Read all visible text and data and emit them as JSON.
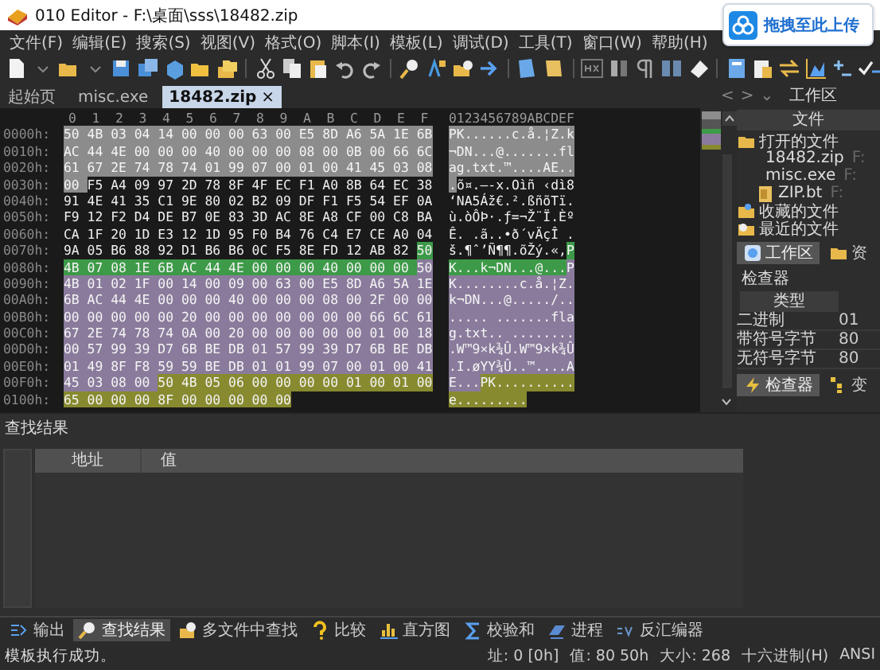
{
  "window": {
    "title": "010 Editor - F:\\桌面\\sss\\18482.zip"
  },
  "upload_widget": {
    "label": "拖拽至此上传"
  },
  "menu": [
    "文件(F)",
    "编辑(E)",
    "搜索(S)",
    "视图(V)",
    "格式(O)",
    "脚本(I)",
    "模板(L)",
    "调试(D)",
    "工具(T)",
    "窗口(W)",
    "帮助(H)"
  ],
  "tabs": [
    {
      "label": "起始页",
      "selected": false
    },
    {
      "label": "misc.exe",
      "selected": false
    },
    {
      "label": "18482.zip",
      "selected": true,
      "close": "×"
    }
  ],
  "workspace_nav": {
    "prev": "<",
    "next": ">",
    "menu": "⌄",
    "title": "工作区"
  },
  "hex_view": {
    "column_headers": [
      "0",
      "1",
      "2",
      "3",
      "4",
      "5",
      "6",
      "7",
      "8",
      "9",
      "A",
      "B",
      "C",
      "D",
      "E",
      "F"
    ],
    "text_header": "0123456789ABCDEF",
    "rows": [
      {
        "offset": "0000h:",
        "segments": [
          {
            "bytes": "50 4B 03 04 14 00 00 00 63 00 E5 8D A6 5A 1E 6B",
            "text": "PK......c.å.¦Z.k",
            "color": "#8c8c8c"
          }
        ]
      },
      {
        "offset": "0010h:",
        "segments": [
          {
            "bytes": "AC 44 4E 00 00 00 40 00 00 00 08 00 0B 00 66 6C",
            "text": "¬DN...@.......fl",
            "color": "#8c8c8c"
          }
        ]
      },
      {
        "offset": "0020h:",
        "segments": [
          {
            "bytes": "61 67 2E 74 78 74 01 99 07 00 01 00 41 45 03 08",
            "text": "ag.txt.™....AE..",
            "color": "#8c8c8c"
          }
        ]
      },
      {
        "offset": "0030h:",
        "segments": [
          {
            "bytes": "00",
            "text": ".",
            "color": "#8c8c8c"
          },
          {
            "bytes": "F5 A4 09 97 2D 78 8F 4F EC F1 A0 8B 64 EC 38",
            "text": "õ¤.—-x.Oìñ ‹dì8"
          }
        ]
      },
      {
        "offset": "0040h:",
        "segments": [
          {
            "bytes": "91 4E 41 35 C1 9E 80 02 B2 09 DF F1 F5 54 EF 0A",
            "text": "‘NA5Áž€.².ßñõTï."
          }
        ]
      },
      {
        "offset": "0050h:",
        "segments": [
          {
            "bytes": "F9 12 F2 D4 DE B7 0E 83 3D AC 8E A8 CF 00 C8 BA",
            "text": "ù.òÔÞ·.ƒ=¬Ž¨Ï.Èº"
          }
        ]
      },
      {
        "offset": "0060h:",
        "segments": [
          {
            "bytes": "CA 1F 20 1D E3 12 1D 95 F0 B4 76 C4 E7 CE A0 04",
            "text": "Ê. .ã..•ð´vÄçÎ ."
          }
        ]
      },
      {
        "offset": "0070h:",
        "segments": [
          {
            "bytes": "9A 05 B6 88 92 D1 B6 B6 0C F5 8E FD 12 AB 82",
            "text": "š.¶ˆ’Ñ¶¶.õŽý.«‚"
          },
          {
            "bytes": "50",
            "text": "P",
            "color": "#3d9a48"
          }
        ]
      },
      {
        "offset": "0080h:",
        "segments": [
          {
            "bytes": "4B 07 08 1E 6B AC 44 4E 00 00 00 40 00 00 00",
            "text": "K...k¬DN...@...",
            "color": "#3d9a48"
          },
          {
            "bytes": "50",
            "text": "P",
            "color": "#8a7b9c"
          }
        ]
      },
      {
        "offset": "0090h:",
        "segments": [
          {
            "bytes": "4B 01 02 1F 00 14 00 09 00 63 00 E5 8D A6 5A 1E",
            "text": "K........c.å.¦Z.",
            "color": "#8a7b9c"
          }
        ]
      },
      {
        "offset": "00A0h:",
        "segments": [
          {
            "bytes": "6B AC 44 4E 00 00 00 40 00 00 00 08 00 2F 00 00",
            "text": "k¬DN...@...../..",
            "color": "#8a7b9c"
          }
        ]
      },
      {
        "offset": "00B0h:",
        "segments": [
          {
            "bytes": "00 00 00 00 00 20 00 00 00 00 00 00 00 66 6C 61",
            "text": "..... .......fla",
            "color": "#8a7b9c"
          }
        ]
      },
      {
        "offset": "00C0h:",
        "segments": [
          {
            "bytes": "67 2E 74 78 74 0A 00 20 00 00 00 00 00 01 00 18",
            "text": "g.txt.. ........",
            "color": "#8a7b9c"
          }
        ]
      },
      {
        "offset": "00D0h:",
        "segments": [
          {
            "bytes": "00 57 99 39 D7 6B BE DB 01 57 99 39 D7 6B BE DB",
            "text": ".W™9×k¾Û.W™9×k¾Û",
            "color": "#8a7b9c"
          }
        ]
      },
      {
        "offset": "00E0h:",
        "segments": [
          {
            "bytes": "01 49 8F F8 59 59 BE DB 01 01 99 07 00 01 00 41",
            "text": ".I.øYY¾Û..™....A",
            "color": "#8a7b9c"
          }
        ]
      },
      {
        "offset": "00F0h:",
        "segments": [
          {
            "bytes": "45 03 08 00",
            "text": "E...",
            "color": "#8a7b9c"
          },
          {
            "bytes": "50 4B 05 06 00 00 00 00 01 00 01 00",
            "text": "PK..........",
            "color": "#878a2f"
          }
        ]
      },
      {
        "offset": "0100h:",
        "segments": [
          {
            "bytes": "65 00 00 00 8F 00 00 00 00 00",
            "text": "e.........",
            "color": "#878a2f"
          }
        ]
      }
    ]
  },
  "workspace_panel": {
    "header": "文件",
    "tree": [
      {
        "label": "打开的文件",
        "kind": "folder",
        "children": [
          {
            "label": "18482.zip",
            "path": "F:",
            "kind": "file"
          },
          {
            "label": "misc.exe",
            "path": "F:",
            "kind": "file"
          },
          {
            "label": "ZIP.bt",
            "path": "F:",
            "kind": "template"
          }
        ]
      },
      {
        "label": "收藏的文件",
        "kind": "favorites"
      },
      {
        "label": "最近的文件",
        "kind": "recent"
      }
    ],
    "tabs": [
      {
        "label": "工作区",
        "selected": true,
        "kind": "workspace"
      },
      {
        "label": "资",
        "selected": false,
        "kind": "folder"
      }
    ]
  },
  "inspector": {
    "title": "检查器",
    "header": "类型",
    "rows": [
      {
        "type": "二进制",
        "value": "01"
      },
      {
        "type": "带符号字节",
        "value": "80"
      },
      {
        "type": "无符号字节",
        "value": "80"
      }
    ],
    "tabs": [
      {
        "label": "检查器",
        "selected": true,
        "kind": "bolt"
      },
      {
        "label": "变",
        "selected": false,
        "kind": "vars"
      }
    ]
  },
  "find_results": {
    "title": "查找结果",
    "columns": [
      "地址",
      "值"
    ]
  },
  "bottom_tabs": [
    {
      "label": "输出",
      "selected": false,
      "kind": "output"
    },
    {
      "label": "查找结果",
      "selected": true,
      "kind": "find"
    },
    {
      "label": "多文件中查找",
      "selected": false,
      "kind": "findfiles"
    },
    {
      "label": "比较",
      "selected": false,
      "kind": "compare"
    },
    {
      "label": "直方图",
      "selected": false,
      "kind": "histogram"
    },
    {
      "label": "校验和",
      "selected": false,
      "kind": "checksum"
    },
    {
      "label": "进程",
      "selected": false,
      "kind": "process"
    },
    {
      "label": "反汇编器",
      "selected": false,
      "kind": "disasm"
    }
  ],
  "status_bar": {
    "message": "模板执行成功。",
    "fields": [
      "址: 0 [0h]",
      "值: 80 50h",
      "大小: 268",
      "十六进制(H)",
      "ANSI"
    ]
  }
}
